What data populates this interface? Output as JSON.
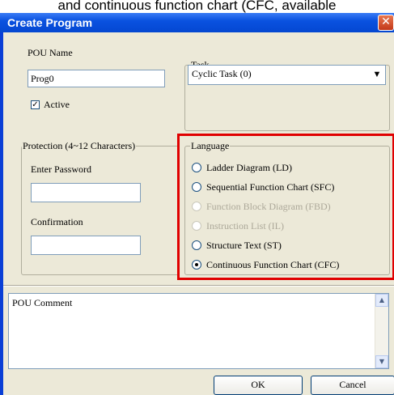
{
  "caption": "and continuous function chart (CFC, available",
  "window": {
    "title": "Create Program",
    "close_glyph": "✕"
  },
  "pou": {
    "name_label": "POU Name",
    "name_value": "Prog0",
    "active_label": "Active",
    "active_checked": true
  },
  "task": {
    "group_label": "Task",
    "selected": "Cyclic Task (0)"
  },
  "protection": {
    "group_label": "Protection (4~12 Characters)",
    "password_label": "Enter Password",
    "password_value": "",
    "confirmation_label": "Confirmation",
    "confirmation_value": ""
  },
  "language": {
    "group_label": "Language",
    "options": [
      {
        "label": "Ladder Diagram (LD)",
        "enabled": true,
        "selected": false
      },
      {
        "label": "Sequential Function Chart (SFC)",
        "enabled": true,
        "selected": false
      },
      {
        "label": "Function Block Diagram (FBD)",
        "enabled": false,
        "selected": false
      },
      {
        "label": "Instruction List (IL)",
        "enabled": false,
        "selected": false
      },
      {
        "label": "Structure Text (ST)",
        "enabled": true,
        "selected": false
      },
      {
        "label": "Continuous Function Chart (CFC)",
        "enabled": true,
        "selected": true
      }
    ],
    "highlight_color": "#e00000"
  },
  "comment": {
    "label": "POU Comment"
  },
  "buttons": {
    "ok": "OK",
    "cancel": "Cancel"
  },
  "icons": {
    "dropdown": "chevron-down-icon",
    "close": "close-icon",
    "check": "check-icon"
  }
}
